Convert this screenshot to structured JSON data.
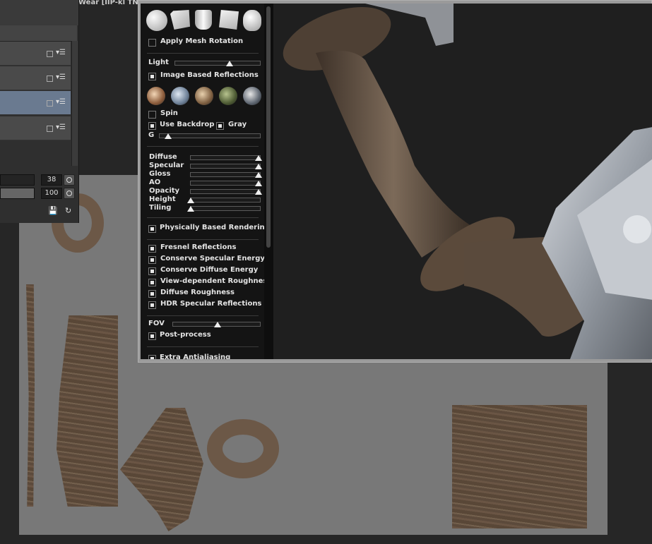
{
  "window": {
    "title_fragment": "Wear [IIP-kl TN("
  },
  "layers_panel": {
    "opacity_value": "38",
    "size_value": "100",
    "icons": [
      "save-icon",
      "refresh-icon",
      "eye-icon",
      "layer-menu-icon"
    ]
  },
  "render_panel": {
    "primitives": [
      "sphere",
      "cube",
      "cylinder",
      "plane",
      "model"
    ],
    "apply_mesh_rotation": {
      "label": "Apply Mesh Rotation",
      "checked": false
    },
    "light_label": "Light",
    "light_value": 0.54,
    "ibr": {
      "label": "Image Based Reflections",
      "checked": true
    },
    "spin": {
      "label": "Spin",
      "checked": false
    },
    "use_backdrop": {
      "label": "Use Backdrop",
      "checked": true
    },
    "gray": {
      "label": "Gray",
      "checked": true
    },
    "g_label": "G",
    "g_value": 0.02,
    "channels": [
      {
        "label": "Diffuse",
        "value": 1.0
      },
      {
        "label": "Specular",
        "value": 1.0
      },
      {
        "label": "Gloss",
        "value": 1.0
      },
      {
        "label": "AO",
        "value": 1.0
      },
      {
        "label": "Opacity",
        "value": 1.0
      },
      {
        "label": "Height",
        "value": 0.0
      },
      {
        "label": "Tiling",
        "value": 0.0
      }
    ],
    "pbr": {
      "label": "Physically Based Rendering",
      "checked": true
    },
    "options": [
      {
        "label": "Fresnel Reflections",
        "checked": true
      },
      {
        "label": "Conserve Specular Energy",
        "checked": true
      },
      {
        "label": "Conserve Diffuse Energy",
        "checked": true
      },
      {
        "label": "View-dependent Roughness",
        "checked": true
      },
      {
        "label": "Diffuse Roughness",
        "checked": true
      },
      {
        "label": "HDR Specular Reflections",
        "checked": true
      }
    ],
    "fov_label": "FOV",
    "fov_value": 0.5,
    "post_process": {
      "label": "Post-process",
      "checked": true
    },
    "extra_label": "Extra Antialiasing"
  },
  "colors": {
    "panel_bg": "#141414",
    "canvas_bg": "#787878",
    "selected_layer": "#6a7a90",
    "viewport_bg": "#1f1f1f"
  }
}
